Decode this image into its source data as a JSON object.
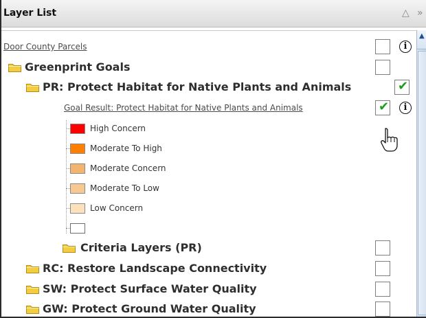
{
  "panel": {
    "title": "Layer List",
    "collapse_glyph": "△",
    "close_glyph": "»"
  },
  "layers": {
    "door_county": {
      "label": "Door County Parcels",
      "checked": false,
      "info": "i"
    },
    "greenprint": {
      "label": "Greenprint Goals",
      "checked": false
    },
    "pr": {
      "label": "PR: Protect Habitat for Native Plants and Animals",
      "checked": true
    },
    "goal_result": {
      "label": "Goal Result: Protect Habitat for Native Plants and Animals",
      "checked": true,
      "info": "i"
    },
    "criteria_pr": {
      "label": "Criteria Layers (PR)",
      "checked": false
    },
    "rc": {
      "label": "RC: Restore Landscape Connectivity",
      "checked": false
    },
    "sw": {
      "label": "SW: Protect Surface Water Quality",
      "checked": false
    },
    "gw": {
      "label": "GW: Protect Ground Water Quality",
      "checked": false
    }
  },
  "legend": [
    {
      "label": "High Concern",
      "color": "#ff0000"
    },
    {
      "label": "Moderate To High",
      "color": "#ff7f00"
    },
    {
      "label": "Moderate Concern",
      "color": "#f3b46e"
    },
    {
      "label": "Moderate To Low",
      "color": "#f7c890"
    },
    {
      "label": "Low Concern",
      "color": "#fbe2bd"
    },
    {
      "label": "",
      "color": "#ffffff"
    }
  ],
  "colors": {
    "checkmark": "#1d9d1d",
    "folder": "#f0cd42"
  },
  "icons": {
    "folder": "folder-icon",
    "info": "info-icon",
    "checkmark": "checkmark-icon",
    "cursor": "hand-pointer-icon"
  }
}
